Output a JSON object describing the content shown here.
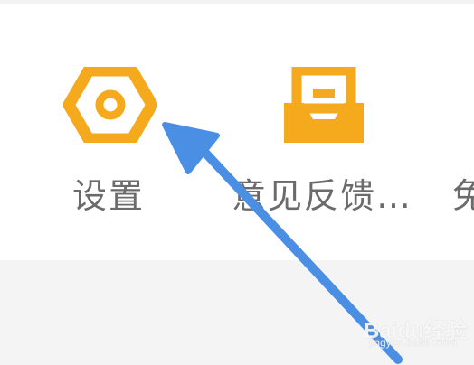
{
  "menu": {
    "items": [
      {
        "label": "设置",
        "icon": "settings-hex-icon"
      },
      {
        "label": "意见反馈…",
        "icon": "feedback-inbox-icon"
      },
      {
        "label": "免",
        "icon": ""
      }
    ]
  },
  "annotation": {
    "arrow_color": "#4a8fe3",
    "target": "settings"
  },
  "watermark": {
    "brand": "Baidu经验",
    "site": "jingyan.baidu.com"
  },
  "colors": {
    "icon_orange": "#f5a91d",
    "label_gray": "#6b6b6b",
    "background": "#ffffff",
    "bottom_area": "#f4f4f4"
  }
}
